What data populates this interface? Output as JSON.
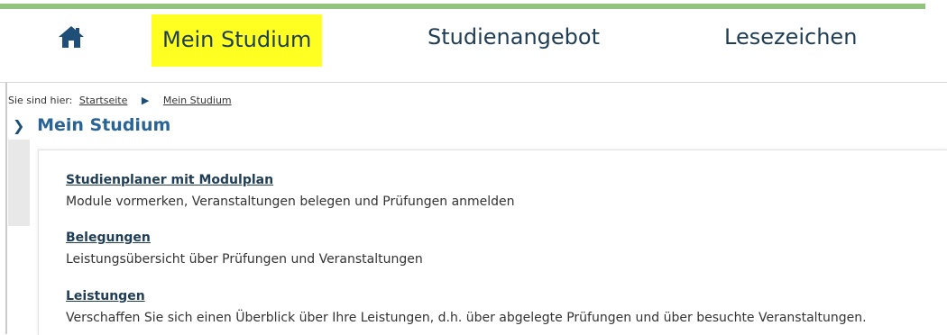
{
  "nav": {
    "home_icon": "home-icon",
    "items": [
      {
        "label": "Mein Studium",
        "highlighted": true,
        "highlight_color": "#ffff22"
      },
      {
        "label": "Studienangebot"
      },
      {
        "label": "Lesezeichen"
      }
    ],
    "accent_color": "#93c47d"
  },
  "breadcrumb": {
    "prefix": "Sie sind hier:",
    "items": [
      "Startseite",
      "Mein Studium"
    ]
  },
  "page": {
    "title": "Mein Studium",
    "entries": [
      {
        "link": "Studienplaner mit Modulplan",
        "description": "Module vormerken, Veranstaltungen belegen und Prüfungen anmelden"
      },
      {
        "link": "Belegungen",
        "description": "Leistungsübersicht über Prüfungen und Veranstaltungen"
      },
      {
        "link": "Leistungen",
        "description": "Verschaffen Sie sich einen Überblick über Ihre Leistungen, d.h. über abgelegte Prüfungen und über besuchte Veranstaltungen."
      }
    ]
  }
}
